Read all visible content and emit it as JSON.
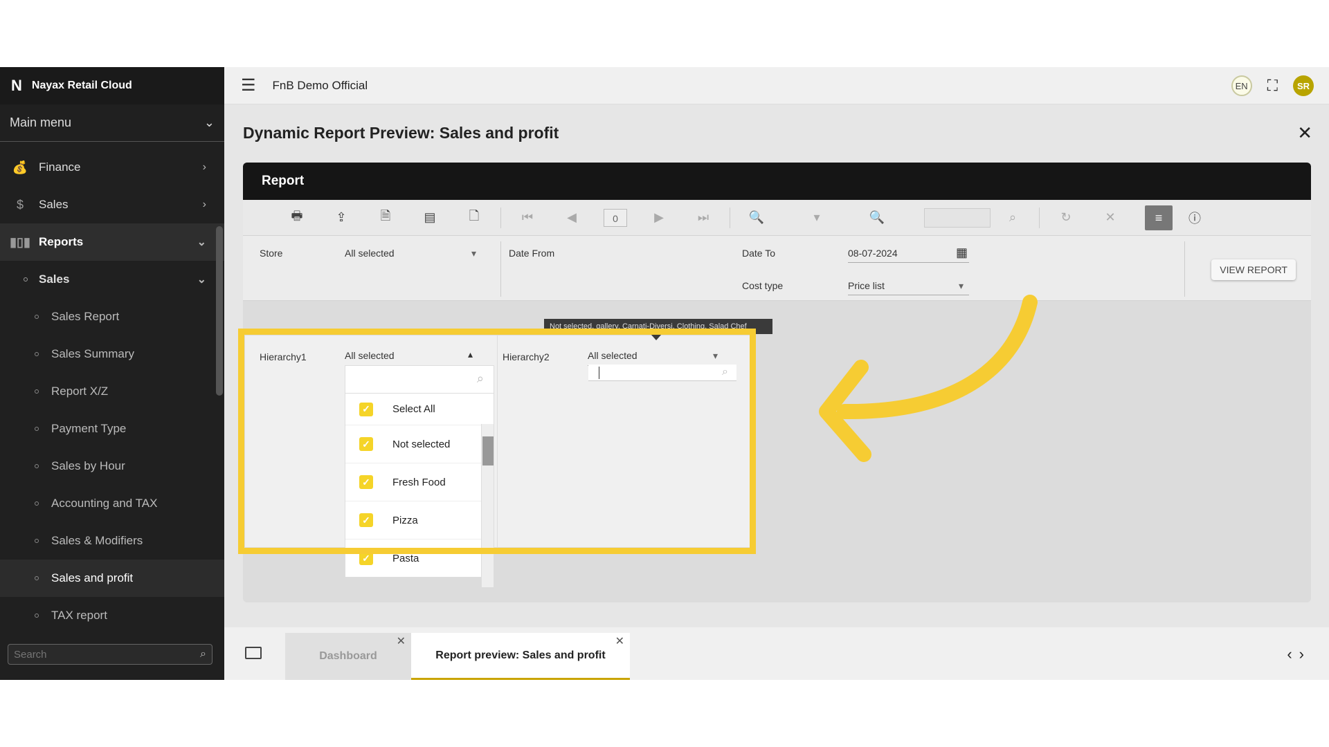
{
  "app": {
    "name": "Nayax Retail Cloud",
    "logo": "N"
  },
  "sidebar": {
    "main_menu": "Main menu",
    "items": [
      {
        "label": "Finance",
        "icon": "finance-icon"
      },
      {
        "label": "Sales",
        "icon": "sales-icon"
      },
      {
        "label": "Reports",
        "icon": "reports-icon"
      }
    ],
    "sub": {
      "label": "Sales"
    },
    "leaves": [
      "Sales Report",
      "Sales Summary",
      "Report X/Z",
      "Payment Type",
      "Sales by Hour",
      "Accounting and TAX",
      "Sales & Modifiers",
      "Sales and profit",
      "TAX report"
    ],
    "selected_leaf": "Sales and profit",
    "search_placeholder": "Search"
  },
  "topbar": {
    "store": "FnB Demo Official",
    "lang": "EN",
    "user_initials": "SR"
  },
  "page": {
    "title": "Dynamic Report Preview: Sales and profit"
  },
  "report": {
    "header": "Report",
    "page_number": "0",
    "params": {
      "store_label": "Store",
      "store_value": "All selected",
      "date_from_label": "Date From",
      "date_to_label": "Date To",
      "date_to_value": "08-07-2024",
      "h1_label": "Hierarchy1",
      "h1_value": "All selected",
      "h2_label": "Hierarchy2",
      "h2_value": "All selected",
      "cost_label": "Cost type",
      "cost_value": "Price list"
    },
    "view_button": "VIEW REPORT"
  },
  "dropdown": {
    "select_all": "Select All",
    "options": [
      "Not selected",
      "Fresh Food",
      "Pizza",
      "Pasta"
    ]
  },
  "tooltip": "Not selected, gallery, Carnati-Diversi, Clothing, Salad Chef",
  "tabs": {
    "dashboard": "Dashboard",
    "report": "Report preview: Sales and profit"
  },
  "colors": {
    "accent": "#f6cc33",
    "sidebar": "#202020",
    "header": "#151515"
  }
}
